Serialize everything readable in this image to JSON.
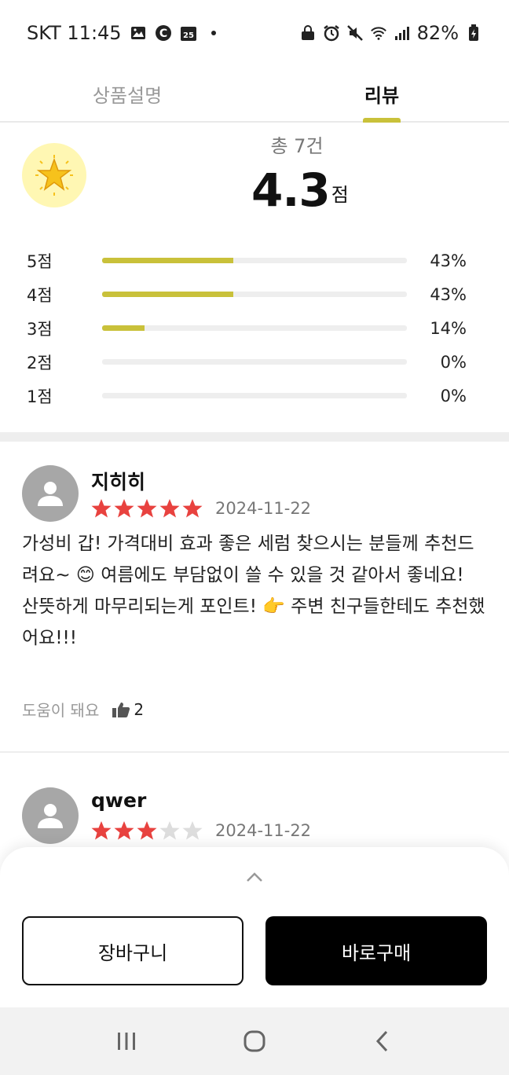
{
  "status_bar": {
    "carrier_time": "SKT 11:45",
    "battery": "82%",
    "left_icons": [
      "gallery-icon",
      "c-circle-icon",
      "calendar-icon",
      "dot-icon"
    ],
    "right_icons": [
      "lock-icon",
      "alarm-icon",
      "mute-icon",
      "wifi-icon",
      "signal-icon",
      "battery-icon"
    ]
  },
  "tabs": [
    {
      "label": "상품설명",
      "active": false
    },
    {
      "label": "리뷰",
      "active": true
    }
  ],
  "summary": {
    "total": "총 7건",
    "average": "4.3",
    "average_unit": "점",
    "distribution": [
      {
        "label": "5점",
        "percent_text": "43%",
        "fraction": 0.43
      },
      {
        "label": "4점",
        "percent_text": "43%",
        "fraction": 0.43
      },
      {
        "label": "3점",
        "percent_text": "14%",
        "fraction": 0.14
      },
      {
        "label": "2점",
        "percent_text": "0%",
        "fraction": 0
      },
      {
        "label": "1점",
        "percent_text": "0%",
        "fraction": 0
      }
    ]
  },
  "reviews": [
    {
      "name": "지히히",
      "rating": 5,
      "date": "2024-11-22",
      "text": "가성비 갑! 가격대비 효과 좋은 세럼 찾으시는 분들께 추천드려요~ 😊 여름에도 부담없이 쓸 수 있을 것 같아서 좋네요! 산뜻하게 마무리되는게 포인트! 👉 주변 친구들한테도 추천했어요!!!",
      "helpful_label": "도움이 돼요",
      "helpful_count": "2"
    },
    {
      "name": "qwer",
      "rating": 3,
      "date": "2024-11-22"
    }
  ],
  "bottom_sheet": {
    "cart_label": "장바구니",
    "buy_label": "바로구매"
  },
  "colors": {
    "accent": "#c9c13a",
    "star": "#e8423f",
    "star_empty": "#dddddd",
    "buy_bg": "#000000"
  }
}
